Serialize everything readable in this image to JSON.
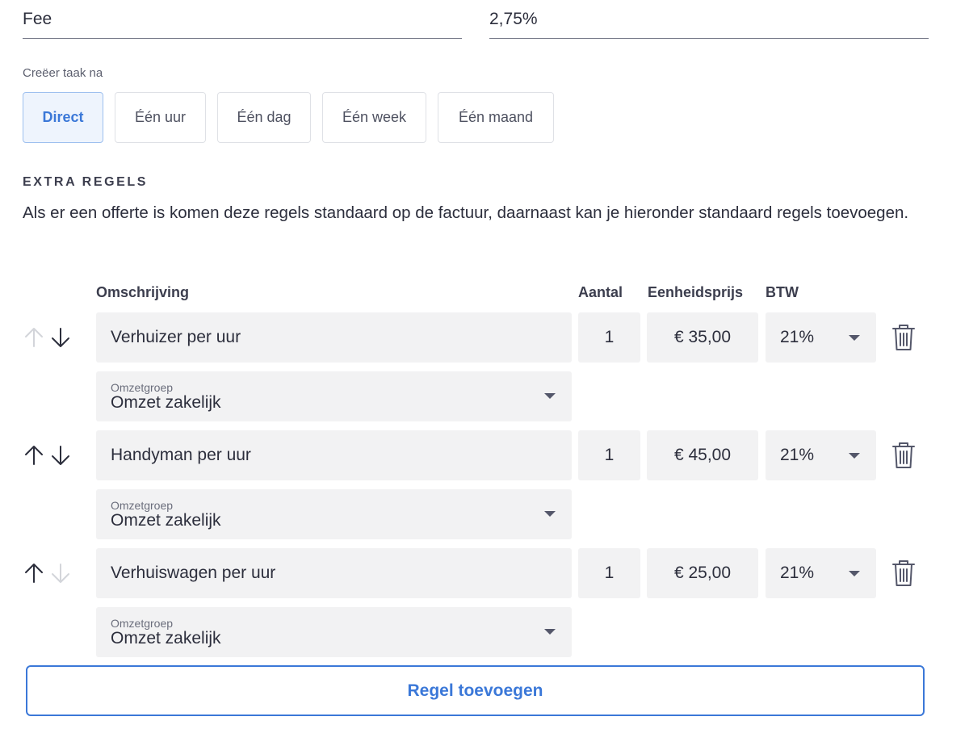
{
  "fee": {
    "label": "Fee",
    "value": "2,75%"
  },
  "timing": {
    "label": "Creëer taak na",
    "options": [
      "Direct",
      "Één uur",
      "Één dag",
      "Één week",
      "Één maand"
    ],
    "selected": "Direct"
  },
  "extra_rules": {
    "title": "EXTRA REGELS",
    "description": "Als er een offerte is komen deze regels standaard op de factuur, daarnaast kan je hieronder standaard regels toevoegen.",
    "columns": {
      "description": "Omschrijving",
      "quantity": "Aantal",
      "unit_price": "Eenheidsprijs",
      "vat": "BTW"
    },
    "rows": [
      {
        "description": "Verhuizer per uur",
        "quantity": "1",
        "unit_price": "€ 35,00",
        "vat": "21%",
        "group_label": "Omzetgroep",
        "group_value": "Omzet zakelijk",
        "up_enabled": false,
        "down_enabled": true
      },
      {
        "description": "Handyman per uur",
        "quantity": "1",
        "unit_price": "€ 45,00",
        "vat": "21%",
        "group_label": "Omzetgroep",
        "group_value": "Omzet zakelijk",
        "up_enabled": true,
        "down_enabled": true
      },
      {
        "description": "Verhuiswagen per uur",
        "quantity": "1",
        "unit_price": "€ 25,00",
        "vat": "21%",
        "group_label": "Omzetgroep",
        "group_value": "Omzet zakelijk",
        "up_enabled": true,
        "down_enabled": false
      }
    ],
    "add_label": "Regel toevoegen"
  },
  "icons": {
    "up": "arrow-up-icon",
    "down": "arrow-down-icon",
    "delete": "trash-icon",
    "dropdown": "chevron-down-icon"
  },
  "colors": {
    "accent": "#3b78d8",
    "field_bg": "#f2f2f3",
    "active_bg": "#eef4fd"
  }
}
